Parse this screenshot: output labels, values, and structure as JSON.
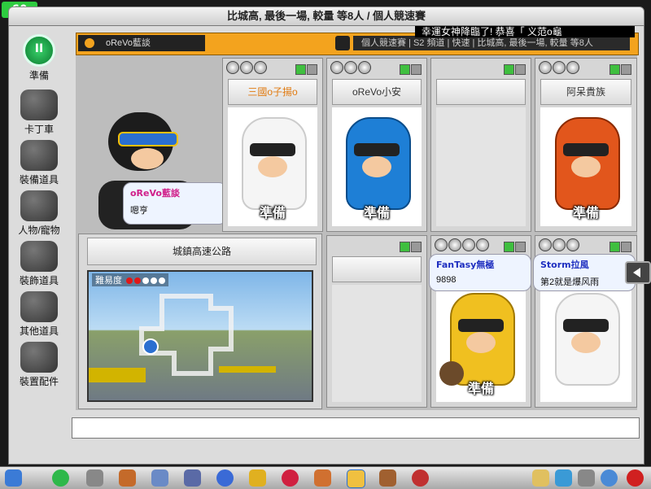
{
  "fps": "60",
  "window_title": "比城高, 最後一場, 較量  等8人  /  個人競速賽",
  "ticker": "幸運女神降臨了! 恭喜「 义范o龜",
  "sidebar": {
    "items": [
      {
        "label": "準備",
        "icon": "ready-icon"
      },
      {
        "label": "卡丁車",
        "icon": "kart-icon"
      },
      {
        "label": "裝備道具",
        "icon": "equipment-icon"
      },
      {
        "label": "人物/寵物",
        "icon": "character-icon"
      },
      {
        "label": "裝飾道具",
        "icon": "decoration-icon"
      },
      {
        "label": "其他道具",
        "icon": "other-items-icon"
      },
      {
        "label": "裝置配件",
        "icon": "parts-icon"
      }
    ]
  },
  "info_bar": {
    "player_name": "oReVo藍談",
    "mode_text": "個人競速賽  |  S2 頻道  |  快速  |  比城高, 最後一場, 較量  等8人"
  },
  "host": {
    "bubble_name": "oReVo藍談",
    "bubble_text": "嗯亨",
    "ready_label": "準備"
  },
  "slots": [
    {
      "name": "三國o子揚o",
      "ready_label": "準備",
      "occupied": true
    },
    {
      "name": "oReVo小安",
      "ready_label": "準備",
      "occupied": true
    },
    {
      "name": "",
      "ready_label": "",
      "occupied": false
    },
    {
      "name": "阿呆貴族",
      "ready_label": "準備",
      "occupied": true
    },
    {
      "name": "",
      "ready_label": "",
      "occupied": false
    },
    {
      "name": "",
      "ready_label": "準備",
      "occupied": true
    },
    {
      "name": "",
      "ready_label": "",
      "occupied": true
    }
  ],
  "bubbles": [
    {
      "name": "FanTasy無極",
      "text": "9898"
    },
    {
      "name": "Storm拉風",
      "text": "第2就是爆风雨"
    }
  ],
  "track": {
    "name": "城鎮高速公路",
    "difficulty_label": "難易度",
    "difficulty_level": 2,
    "difficulty_max": 5
  },
  "colors": {
    "accent_orange": "#f3a31e",
    "ready_green": "#3ad16b",
    "name_blue": "#2030c0",
    "name_pink": "#d0208a"
  }
}
